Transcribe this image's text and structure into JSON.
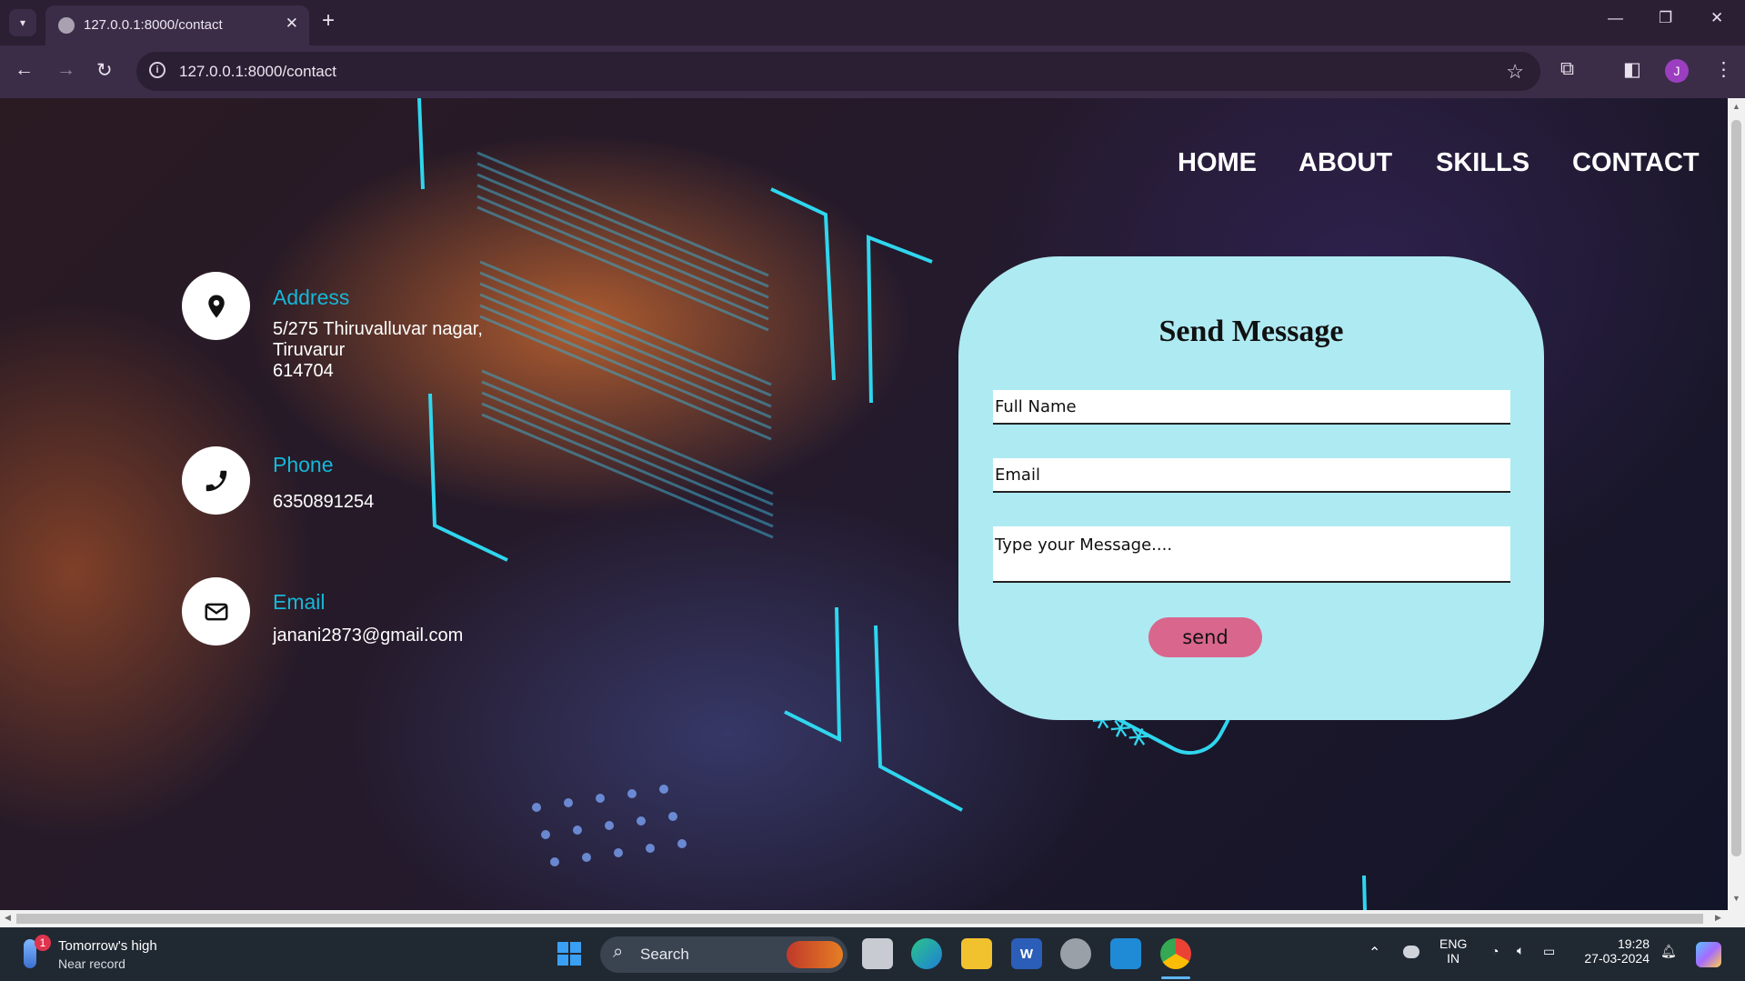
{
  "browser": {
    "tab_title": "127.0.0.1:8000/contact",
    "url": "127.0.0.1:8000/contact",
    "profile_initial": "J"
  },
  "page": {
    "nav": [
      "HOME",
      "ABOUT",
      "SKILLS",
      "CONTACT"
    ],
    "contact_info": [
      {
        "title": "Address",
        "lines": [
          "5/275 Thiruvalluvar nagar,",
          "Tiruvarur",
          "614704"
        ],
        "icon": "location-pin-icon"
      },
      {
        "title": "Phone",
        "lines": [
          "6350891254"
        ],
        "icon": "phone-icon"
      },
      {
        "title": "Email",
        "lines": [
          "janani2873@gmail.com"
        ],
        "icon": "envelope-icon"
      }
    ],
    "form": {
      "title": "Send Message",
      "name_placeholder": "Full Name",
      "email_placeholder": "Email",
      "message_placeholder": "Type your Message....",
      "send_label": "send"
    },
    "password_asterisks": "******"
  },
  "taskbar": {
    "weather_title": "Tomorrow's high",
    "weather_subtitle": "Near record",
    "weather_badge": "1",
    "search_label": "Search",
    "language": "ENG",
    "region": "IN",
    "time": "19:28",
    "date": "27-03-2024"
  },
  "colors": {
    "accent_cyan": "#16b7d8",
    "card_bg": "#aeeaf2",
    "send_button": "#d9668c",
    "browser_chrome": "#3b2d47"
  }
}
